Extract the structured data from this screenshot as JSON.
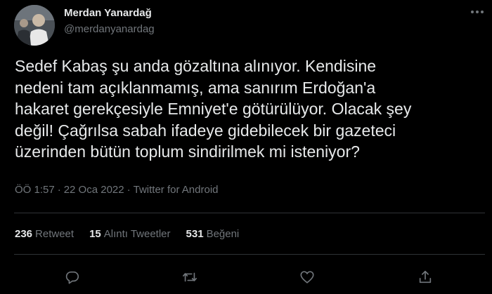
{
  "author": {
    "name": "Merdan Yanardağ",
    "handle": "@merdanyanardag"
  },
  "tweet": {
    "text": "Sedef Kabaş şu anda gözaltına alınıyor. Kendisine\nnedeni tam açıklanmamış, ama sanırım Erdoğan'a\nhakaret gerekçesiyle Emniyet'e götürülüyor. Olacak şey\ndeğil! Çağrılsa sabah ifadeye gidebilecek bir gazeteci\nüzerinden bütün toplum sindirilmek mi isteniyor?"
  },
  "meta": {
    "time": "ÖÖ 1:57",
    "separator": "·",
    "date": "22 Oca 2022",
    "source": "Twitter for Android"
  },
  "stats": {
    "retweets": {
      "count": "236",
      "label": "Retweet"
    },
    "quotes": {
      "count": "15",
      "label": "Alıntı Tweetler"
    },
    "likes": {
      "count": "531",
      "label": "Beğeni"
    }
  },
  "icons": {
    "more": "more-icon",
    "reply": "reply-icon",
    "retweet": "retweet-icon",
    "like": "like-icon",
    "share": "share-icon"
  },
  "colors": {
    "background": "#000000",
    "text": "#e7e9ea",
    "secondary": "#71767b",
    "divider": "#2f3336"
  }
}
